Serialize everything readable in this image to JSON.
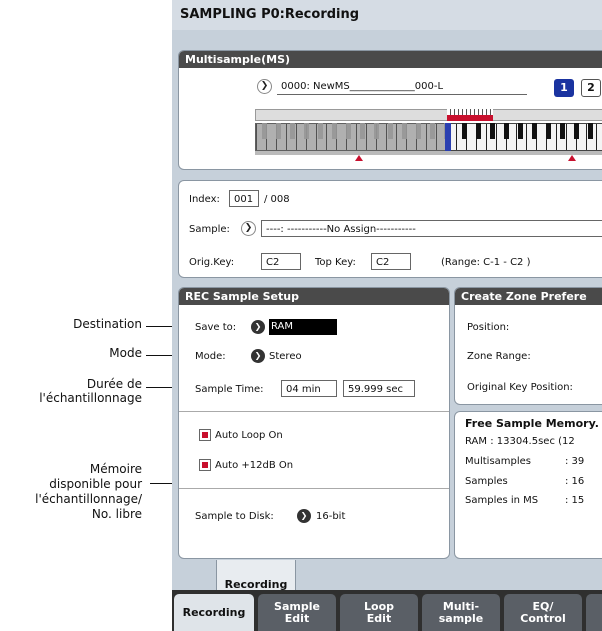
{
  "title": "SAMPLING P0:Recording",
  "multisample": {
    "header": "Multisample(MS)",
    "name": "0000: NewMS_____________000-L",
    "btn1": "1",
    "btn2": "2"
  },
  "index": {
    "label": "Index:",
    "value": "001",
    "total": "/ 008",
    "sample_label": "Sample:",
    "sample_value": "----: -----------No Assign-----------",
    "origkey_label": "Orig.Key:",
    "origkey_value": "C2",
    "topkey_label": "Top Key:",
    "topkey_value": "C2",
    "range_text": "(Range: C-1   - C2   )"
  },
  "rec_setup": {
    "header": "REC Sample Setup",
    "save_label": "Save to:",
    "save_value": "RAM",
    "mode_label": "Mode:",
    "mode_value": "Stereo",
    "time_label": "Sample Time:",
    "time_min": "04 min",
    "time_sec": "59.999 sec",
    "autoloop": "Auto Loop On",
    "auto12": "Auto +12dB On",
    "disk_label": "Sample to Disk:",
    "disk_value": "16-bit"
  },
  "zone_pref": {
    "header": "Create Zone Prefere",
    "position": "Position:",
    "zone_range": "Zone Range:",
    "orig_key_pos": "Original Key Position:"
  },
  "free_mem": {
    "header": "Free Sample Memory.",
    "ram": "RAM :  13304.5sec  (12",
    "multisamples_label": "Multisamples",
    "multisamples_value": ": 39",
    "samples_label": "Samples",
    "samples_value": ": 16",
    "samples_ms_label": "Samples in MS",
    "samples_ms_value": ": 15"
  },
  "page_tab": "Recording",
  "tabs": [
    {
      "label": "Recording"
    },
    {
      "label": "Sample\nEdit"
    },
    {
      "label": "Loop\nEdit"
    },
    {
      "label": "Multi-\nsample"
    },
    {
      "label": "EQ/\nControl"
    }
  ],
  "callouts": {
    "destination": "Destination",
    "mode": "Mode",
    "duree1": "Durée de",
    "duree2": "l'échantillonnage",
    "mem1": "Mémoire",
    "mem2": "disponible pour",
    "mem3": "l'échantillonnage/",
    "mem4": "No. libre"
  },
  "colors": {
    "screen_bg": "#c6d0da",
    "header_dark": "#4a4a4a",
    "checkbox_red": "#c8102e",
    "selected_key": "#2a3fb0"
  }
}
